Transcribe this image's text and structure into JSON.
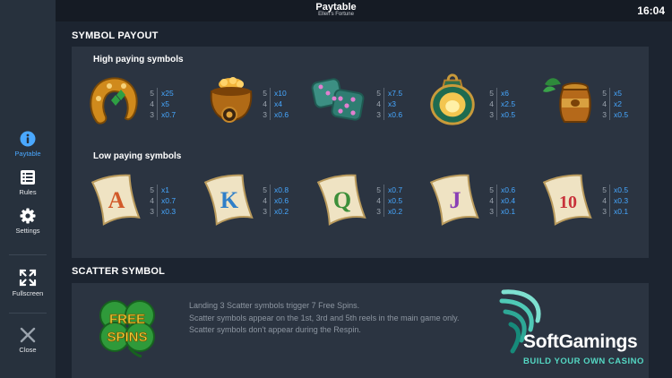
{
  "header": {
    "title": "Paytable",
    "subtitle": "Ellen's Fortune",
    "clock": "16:04"
  },
  "sidebar": {
    "items": [
      {
        "label": "Paytable",
        "icon": "info-icon",
        "active": true
      },
      {
        "label": "Rules",
        "icon": "list-icon"
      },
      {
        "label": "Settings",
        "icon": "gear-icon"
      },
      {
        "label": "Fullscreen",
        "icon": "fullscreen-icon"
      },
      {
        "label": "Close",
        "icon": "close-icon"
      }
    ]
  },
  "symbol_payout": {
    "heading": "SYMBOL PAYOUT",
    "high_heading": "High paying symbols",
    "low_heading": "Low paying symbols",
    "high": [
      {
        "icon": "horseshoe-icon",
        "pays": [
          [
            "5",
            "x25"
          ],
          [
            "4",
            "x5"
          ],
          [
            "3",
            "x0.7"
          ]
        ]
      },
      {
        "icon": "pot-of-gold-icon",
        "pays": [
          [
            "5",
            "x10"
          ],
          [
            "4",
            "x4"
          ],
          [
            "3",
            "x0.6"
          ]
        ]
      },
      {
        "icon": "dice-icon",
        "pays": [
          [
            "5",
            "x7.5"
          ],
          [
            "4",
            "x3"
          ],
          [
            "3",
            "x0.6"
          ]
        ]
      },
      {
        "icon": "lantern-icon",
        "pays": [
          [
            "5",
            "x6"
          ],
          [
            "4",
            "x2.5"
          ],
          [
            "3",
            "x0.5"
          ]
        ]
      },
      {
        "icon": "honey-jar-icon",
        "pays": [
          [
            "5",
            "x5"
          ],
          [
            "4",
            "x2"
          ],
          [
            "3",
            "x0.5"
          ]
        ]
      }
    ],
    "low": [
      {
        "icon": "scroll-a-icon",
        "letter": "A",
        "color": "#d25a2a",
        "pays": [
          [
            "5",
            "x1"
          ],
          [
            "4",
            "x0.7"
          ],
          [
            "3",
            "x0.3"
          ]
        ]
      },
      {
        "icon": "scroll-k-icon",
        "letter": "K",
        "color": "#2f7fc8",
        "pays": [
          [
            "5",
            "x0.8"
          ],
          [
            "4",
            "x0.6"
          ],
          [
            "3",
            "x0.2"
          ]
        ]
      },
      {
        "icon": "scroll-q-icon",
        "letter": "Q",
        "color": "#3d8f3a",
        "pays": [
          [
            "5",
            "x0.7"
          ],
          [
            "4",
            "x0.5"
          ],
          [
            "3",
            "x0.2"
          ]
        ]
      },
      {
        "icon": "scroll-j-icon",
        "letter": "J",
        "color": "#8a3fb5",
        "pays": [
          [
            "5",
            "x0.6"
          ],
          [
            "4",
            "x0.4"
          ],
          [
            "3",
            "x0.1"
          ]
        ]
      },
      {
        "icon": "scroll-10-icon",
        "letter": "10",
        "color": "#c8323a",
        "pays": [
          [
            "5",
            "x0.5"
          ],
          [
            "4",
            "x0.3"
          ],
          [
            "3",
            "x0.1"
          ]
        ]
      }
    ]
  },
  "scatter": {
    "heading": "SCATTER SYMBOL",
    "symbol_line1": "FREE",
    "symbol_line2": "SPINS",
    "lines": [
      "Landing 3 Scatter symbols trigger 7 Free Spins.",
      "Scatter symbols appear on the 1st, 3rd and 5th reels in the main game only.",
      "Scatter symbols don't appear during the Respin."
    ]
  },
  "watermark": {
    "name": "SoftGamings",
    "tagline": "BUILD YOUR OWN CASINO"
  },
  "colors": {
    "accent": "#46a7ff",
    "panel": "#2b3441",
    "sidebar": "#27313d"
  }
}
